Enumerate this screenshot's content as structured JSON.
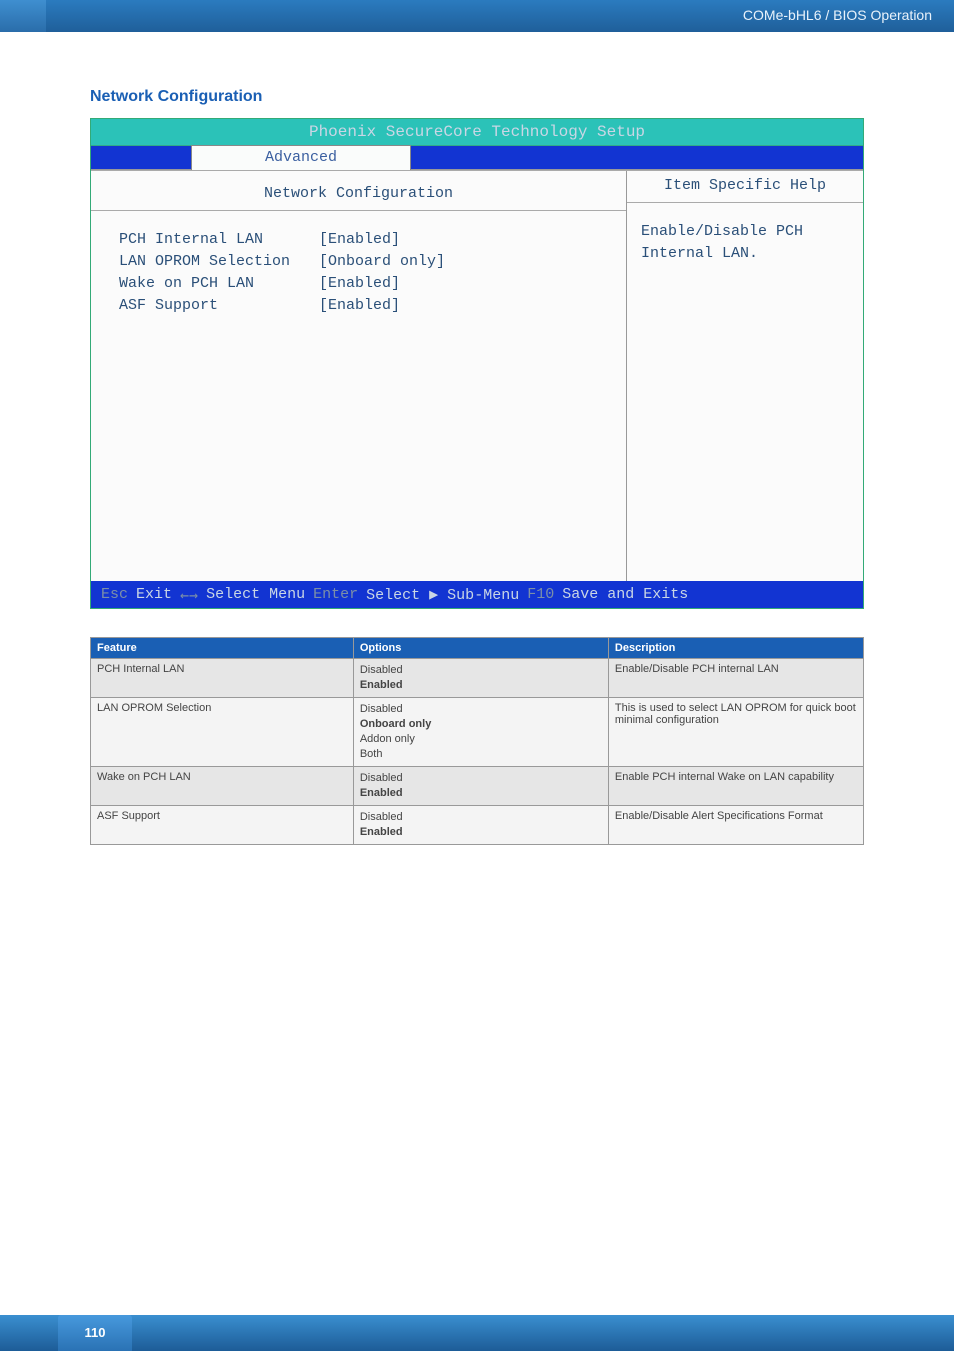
{
  "header": {
    "breadcrumb": "COMe-bHL6 / BIOS Operation"
  },
  "section": {
    "title": "Network Configuration"
  },
  "bios": {
    "title": "Phoenix SecureCore Technology Setup",
    "tab_active": "Advanced",
    "left_head": "Network Configuration",
    "right_head": "Item Specific Help",
    "rows": [
      {
        "label": "PCH Internal LAN",
        "value": "[Enabled]"
      },
      {
        "label": "LAN OPROM Selection",
        "value": "[Onboard only]"
      },
      {
        "label": "Wake on PCH LAN",
        "value": "[Enabled]"
      },
      {
        "label": "ASF Support",
        "value": "[Enabled]"
      }
    ],
    "help_text": "Enable/Disable PCH Internal LAN.",
    "footer": {
      "esc_key": "Esc",
      "esc_label": "Exit",
      "lr_key": "←→",
      "lr_label": "Select Menu",
      "enter_key": "Enter",
      "enter_label": "Select ▶ Sub-Menu",
      "f10_key": "F10",
      "f10_label": "Save and Exits"
    }
  },
  "table": {
    "headers": {
      "feature": "Feature",
      "options": "Options",
      "description": "Description"
    },
    "rows": [
      {
        "feature": "PCH Internal LAN",
        "options": [
          {
            "t": "Disabled"
          },
          {
            "t": "Enabled",
            "b": true
          }
        ],
        "description": "Enable/Disable PCH internal LAN"
      },
      {
        "feature": "LAN OPROM Selection",
        "options": [
          {
            "t": "Disabled"
          },
          {
            "t": "Onboard only",
            "b": true
          },
          {
            "t": "Addon only"
          },
          {
            "t": "Both"
          }
        ],
        "description": "This is used to select LAN OPROM for quick boot minimal configuration"
      },
      {
        "feature": "Wake on PCH LAN",
        "options": [
          {
            "t": "Disabled"
          },
          {
            "t": "Enabled",
            "b": true
          }
        ],
        "description": "Enable PCH internal Wake on LAN capability"
      },
      {
        "feature": "ASF Support",
        "options": [
          {
            "t": "Disabled"
          },
          {
            "t": "Enabled",
            "b": true
          }
        ],
        "description": "Enable/Disable Alert Specifications Format"
      }
    ]
  },
  "page": {
    "number": "110"
  }
}
